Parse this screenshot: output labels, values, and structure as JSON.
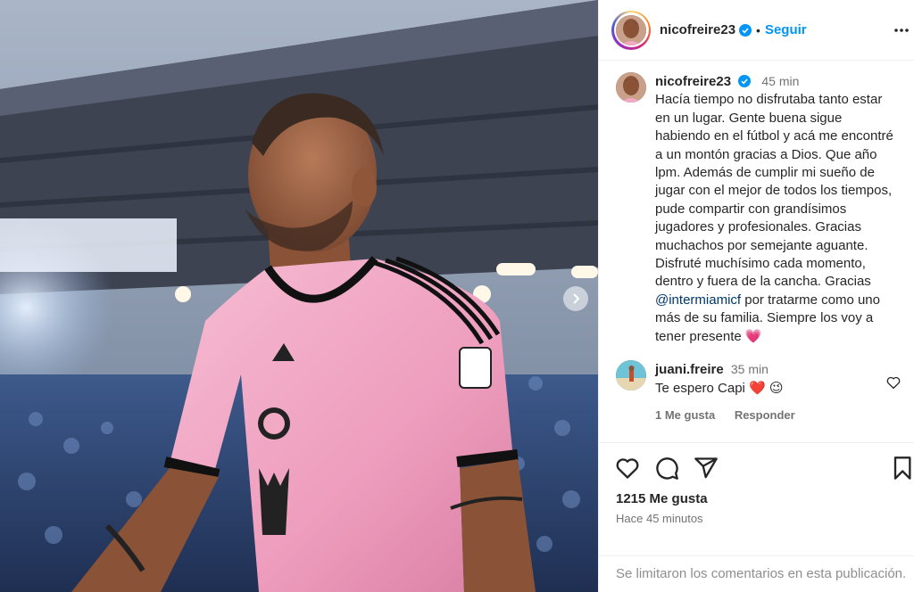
{
  "post": {
    "photo_alt": "Jugador con camiseta rosa del Inter Miami en el estadio",
    "next_slide_label": "Siguiente"
  },
  "header": {
    "username": "nicofreire23",
    "separator": "•",
    "follow_label": "Seguir"
  },
  "caption": {
    "username": "nicofreire23",
    "time": "45 min",
    "text_before_mention": "Hacía tiempo no disfrutaba tanto estar en un lugar. Gente buena sigue habiendo en el fútbol y acá me encontré a un montón gracias a Dios. Que año lpm. Además de cumplir mi sueño de jugar con el mejor de todos los tiempos, pude compartir con grandísimos jugadores y profesionales. Gracias muchachos por semejante aguante. Disfruté muchísimo cada momento, dentro y fuera de la cancha. Gracias ",
    "mention": "@intermiamicf",
    "text_after_mention": " por tratarme como uno más de su familia. Siempre los voy a tener presente 💗"
  },
  "reply": {
    "username": "juani.freire",
    "time": "35 min",
    "text": "Te espero Capi ❤️ 😉",
    "likes_label": "1 Me gusta",
    "reply_label": "Responder"
  },
  "actions": {
    "likes": "1215 Me gusta",
    "posted_ago": "Hace 45 minutos"
  },
  "comment_bar": {
    "text": "Se limitaron los comentarios en esta publicación."
  },
  "icons": [
    "verified-icon",
    "more-options-icon",
    "heart-icon",
    "comment-icon",
    "share-icon",
    "bookmark-icon",
    "chevron-right-icon"
  ],
  "colors": {
    "link_blue": "#0095f6",
    "mention_blue": "#00376b",
    "jersey_pink": "#f2a9c4"
  }
}
